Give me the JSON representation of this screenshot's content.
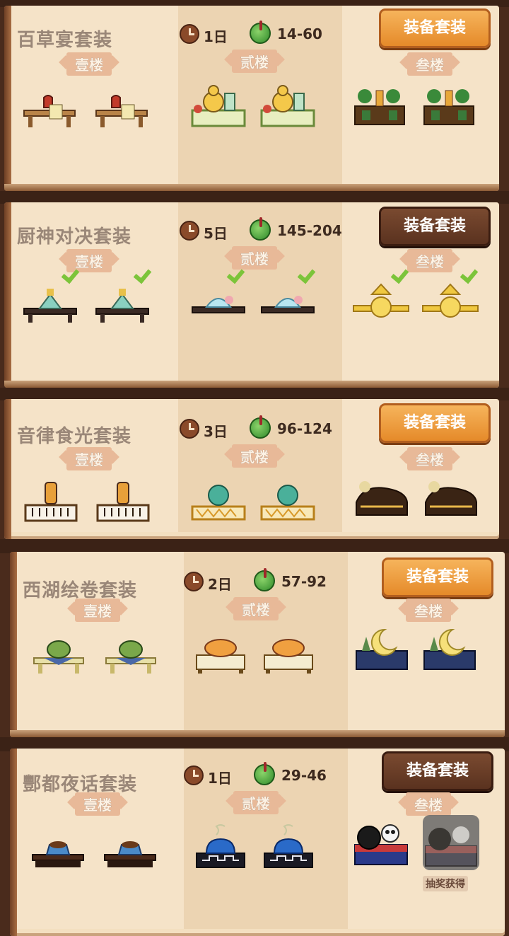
{
  "sets": [
    {
      "title": "百草宴套装",
      "days": "1日",
      "range": "14-60",
      "button": "装备套装",
      "button_style": "orange",
      "floors": [
        "壹楼",
        "贰楼",
        "叁楼"
      ],
      "owned": false
    },
    {
      "title": "厨神对决套装",
      "days": "5日",
      "range": "145-204",
      "button": "装备套装",
      "button_style": "brown",
      "floors": [
        "壹楼",
        "贰楼",
        "叁楼"
      ],
      "owned": true
    },
    {
      "title": "音律食光套装",
      "days": "3日",
      "range": "96-124",
      "button": "装备套装",
      "button_style": "orange",
      "floors": [
        "壹楼",
        "贰楼",
        "叁楼"
      ],
      "owned": false
    },
    {
      "title": "西湖绘卷套装",
      "days": "2日",
      "range": "57-92",
      "button": "装备套装",
      "button_style": "orange",
      "floors": [
        "壹楼",
        "贰楼",
        "叁楼"
      ],
      "owned": false
    },
    {
      "title": "酆都夜话套装",
      "days": "1日",
      "range": "29-46",
      "button": "装备套装",
      "button_style": "brown",
      "floors": [
        "壹楼",
        "贰楼",
        "叁楼"
      ],
      "owned": false,
      "locked_note": "抽奖获得"
    }
  ],
  "colors": {
    "orange_button": "#e58a2a",
    "brown_button": "#5a321f",
    "check": "#7cc43a",
    "panel": "#f3dfc0"
  }
}
